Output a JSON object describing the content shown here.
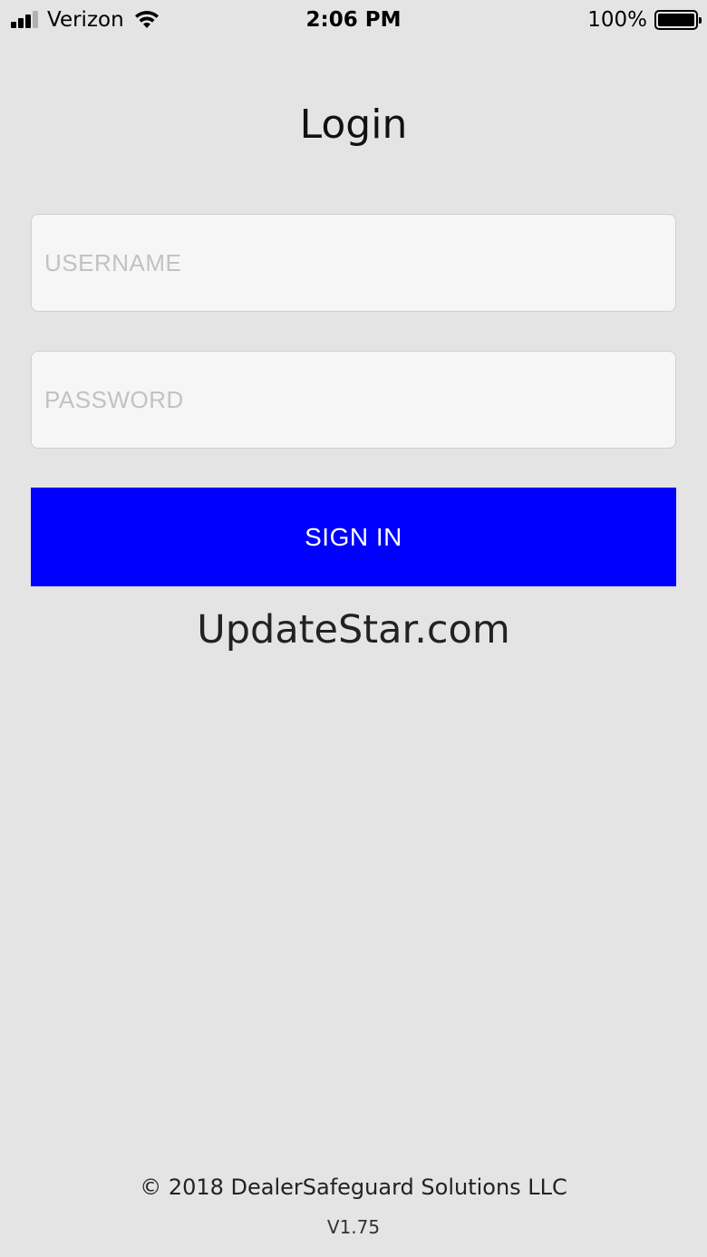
{
  "status_bar": {
    "carrier": "Verizon",
    "time": "2:06 PM",
    "battery_percent": "100%",
    "icons": [
      "signal-icon",
      "wifi-icon",
      "battery-icon"
    ]
  },
  "login": {
    "title": "Login",
    "username_placeholder": "USERNAME",
    "username_value": "",
    "password_placeholder": "PASSWORD",
    "password_value": "",
    "sign_in_label": "SIGN IN"
  },
  "watermark": "UpdateStar.com",
  "footer": {
    "copyright": "© 2018 DealerSafeguard Solutions LLC",
    "version": "V1.75"
  },
  "colors": {
    "background": "#e4e4e4",
    "input_background": "#f6f6f6",
    "primary_button": "#0000ff",
    "button_text": "#ffffff"
  }
}
